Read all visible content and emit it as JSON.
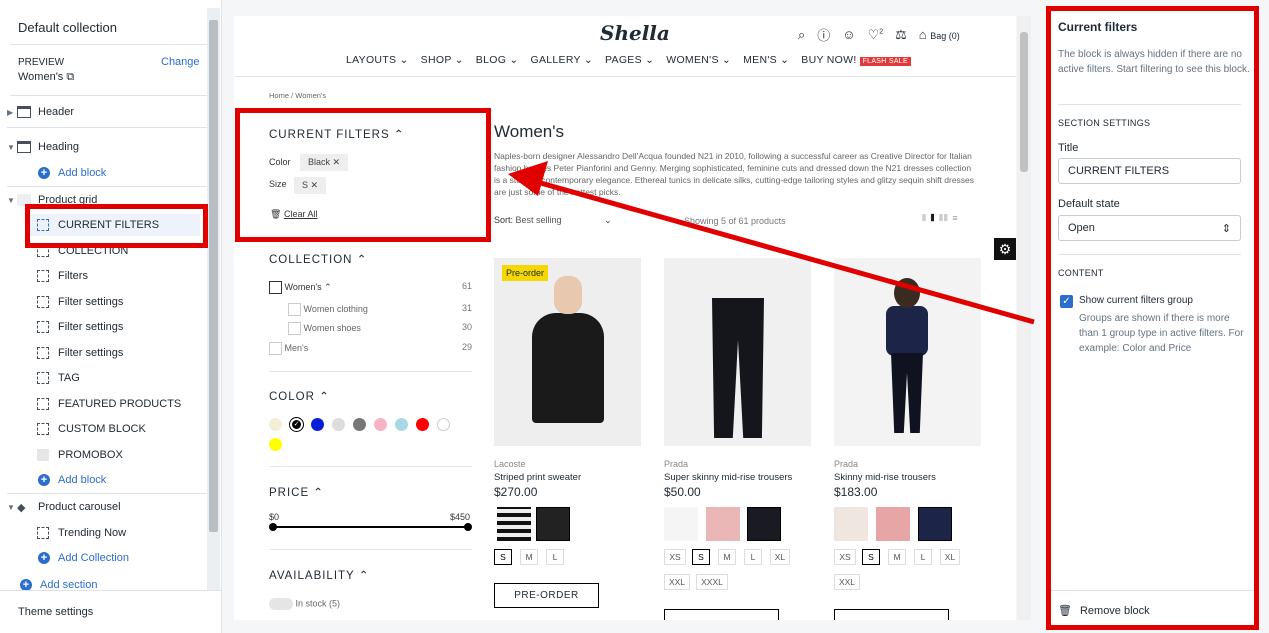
{
  "left": {
    "title": "Default collection",
    "preview_label": "PREVIEW",
    "change": "Change",
    "preview_value": "Women's",
    "tree": [
      {
        "label": "Header"
      },
      {
        "label": "Heading"
      },
      {
        "label": "Add block"
      },
      {
        "label": "Product grid"
      },
      {
        "label": "CURRENT FILTERS"
      },
      {
        "label": "COLLECTION"
      },
      {
        "label": "Filters"
      },
      {
        "label": "Filter settings"
      },
      {
        "label": "Filter settings"
      },
      {
        "label": "Filter settings"
      },
      {
        "label": "TAG"
      },
      {
        "label": "FEATURED PRODUCTS"
      },
      {
        "label": "CUSTOM BLOCK"
      },
      {
        "label": "PROMOBOX"
      },
      {
        "label": "Add block"
      },
      {
        "label": "Product carousel"
      },
      {
        "label": "Trending Now"
      },
      {
        "label": "Add Collection"
      },
      {
        "label": "Add section"
      }
    ],
    "theme_settings": "Theme settings"
  },
  "store": {
    "logo": "Shella",
    "bag": "Bag (0)",
    "wishlist_count": "2",
    "nav": [
      "LAYOUTS",
      "SHOP",
      "BLOG",
      "GALLERY",
      "PAGES",
      "WOMEN'S",
      "MEN'S",
      "BUY NOW!"
    ],
    "flash": "FLASH SALE",
    "breadcrumb": "Home / Women's",
    "filters": {
      "current_title": "CURRENT FILTERS",
      "color_label": "Color",
      "color_value": "Black",
      "size_label": "Size",
      "size_value": "S",
      "clear_all": "Clear All",
      "collection_title": "COLLECTION",
      "collection_items": [
        {
          "label": "Women's",
          "count": "61"
        },
        {
          "label": "Women clothing",
          "count": "31"
        },
        {
          "label": "Women shoes",
          "count": "30"
        },
        {
          "label": "Men's",
          "count": "29"
        }
      ],
      "color_title": "COLOR",
      "price_title": "PRICE",
      "price_min": "$0",
      "price_max": "$450",
      "availability_title": "AVAILABILITY",
      "in_stock": "In stock (5)"
    },
    "page_title": "Women's",
    "description": "Naples-born designer Alessandro Dell'Acqua founded N21 in 2010, following a successful career as Creative Director for Italian fashion houses Peter Pianforini and Genny. Merging sophisticated, feminine cuts and dressed down the N21 dresses collection is a study in contemporary elegance. Ethereal tunics in delicate silks, cutting-edge tailoring styles and glitzy sequin shift dresses are just some of the hottest picks.",
    "sort_label": "Sort:",
    "sort_value": "Best selling",
    "showing": "Showing 5 of 61 products",
    "products": [
      {
        "badge": "Pre-order",
        "brand": "Lacoste",
        "name": "Striped print sweater",
        "price": "$270.00",
        "sizes": [
          "S",
          "M",
          "L"
        ],
        "button": "PRE-ORDER"
      },
      {
        "brand": "Prada",
        "name": "Super skinny mid-rise trousers",
        "price": "$50.00",
        "sizes": [
          "XS",
          "S",
          "M",
          "L",
          "XL",
          "XXL",
          "XXXL"
        ]
      },
      {
        "brand": "Prada",
        "name": "Skinny mid-rise trousers",
        "price": "$183.00",
        "sizes": [
          "XS",
          "S",
          "M",
          "L",
          "XL",
          "XXL"
        ]
      }
    ]
  },
  "right": {
    "title": "Current filters",
    "info": "The block is always hidden if there are no active filters. Start filtering to see this block.",
    "section_settings": "SECTION SETTINGS",
    "title_label": "Title",
    "title_value": "CURRENT FILTERS",
    "default_state_label": "Default state",
    "default_state_value": "Open",
    "content_head": "CONTENT",
    "show_group_label": "Show current filters group",
    "show_group_help": "Groups are shown if there is more than 1 group type in active filters. For example: Color and Price",
    "remove": "Remove block"
  },
  "colors": {
    "highlight": "#e00000",
    "accent": "#2c6ecb"
  }
}
